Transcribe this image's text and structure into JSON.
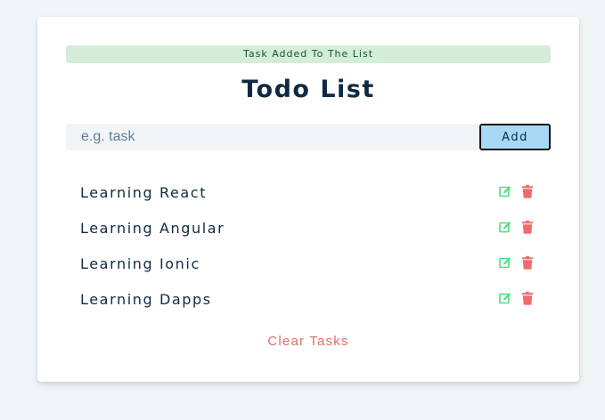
{
  "alert": {
    "text": "Task Added To The List",
    "type": "success"
  },
  "title": "Todo List",
  "form": {
    "input_value": "",
    "input_placeholder": "e.g. task",
    "add_label": "Add"
  },
  "items": [
    {
      "title": "Learning React",
      "edit_icon": "edit-icon",
      "delete_icon": "trash-icon"
    },
    {
      "title": "Learning Angular",
      "edit_icon": "edit-icon",
      "delete_icon": "trash-icon"
    },
    {
      "title": "Learning Ionic",
      "edit_icon": "edit-icon",
      "delete_icon": "trash-icon"
    },
    {
      "title": "Learning Dapps",
      "edit_icon": "edit-icon",
      "delete_icon": "trash-icon"
    }
  ],
  "clear_label": "Clear Tasks",
  "colors": {
    "page_bg": "#f1f5f8",
    "alert_bg": "#d4edda",
    "alert_text": "#155724",
    "add_button_bg": "#a7d8f5",
    "edit_icon": "#4ade80",
    "delete_icon": "#ef6b6b",
    "clear_text": "#e66b6b",
    "title_text": "#102a43"
  }
}
